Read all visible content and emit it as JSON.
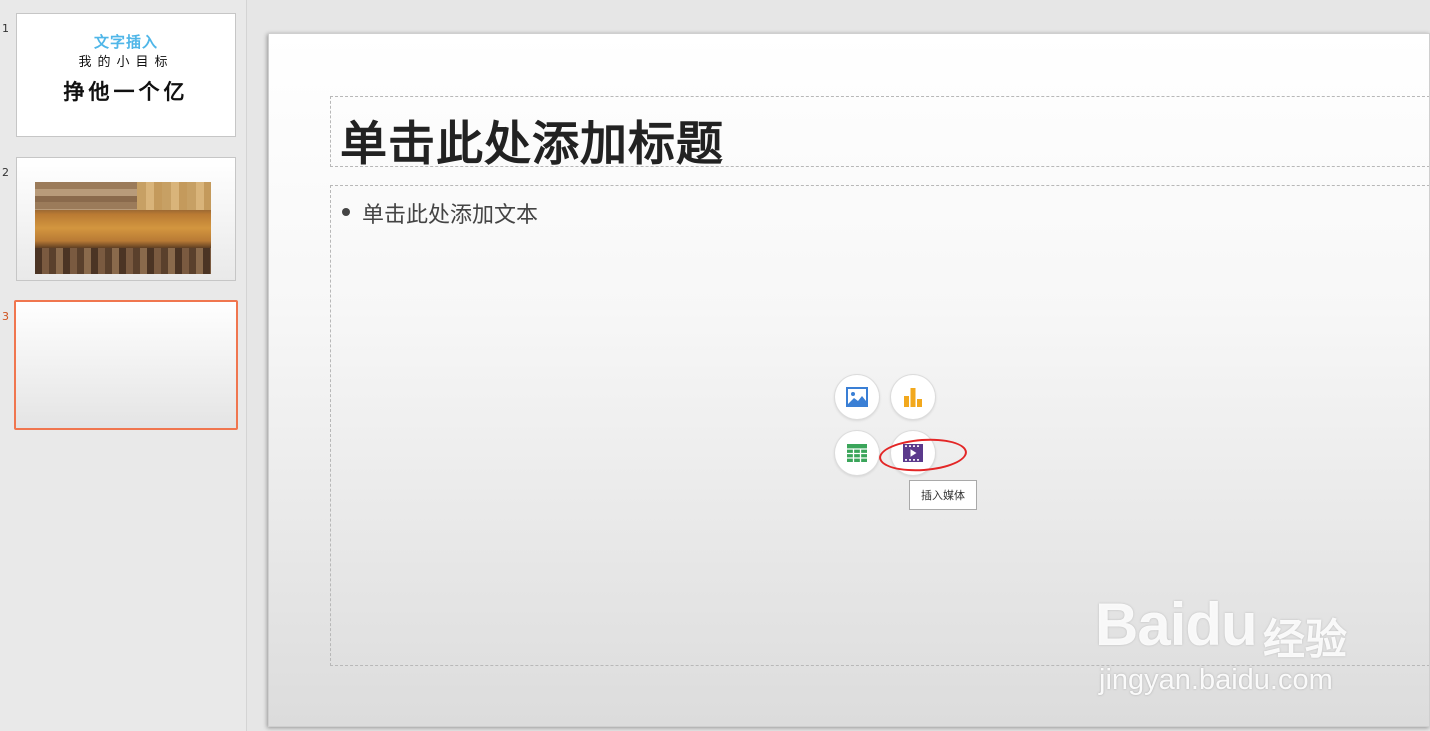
{
  "thumbnails": [
    {
      "number": "1",
      "line1": "文字插入",
      "line2": "我的小目标",
      "line3": "挣他一个亿"
    },
    {
      "number": "2"
    },
    {
      "number": "3"
    }
  ],
  "slide": {
    "title_placeholder": "单击此处添加标题",
    "body_placeholder": "单击此处添加文本"
  },
  "insert_buttons": [
    {
      "name": "insert-picture",
      "icon": "picture-icon",
      "color": "#3a7fd5"
    },
    {
      "name": "insert-chart",
      "icon": "bar-chart-icon",
      "color": "#f2a81d"
    },
    {
      "name": "insert-table",
      "icon": "table-icon",
      "color": "#3aa55a"
    },
    {
      "name": "insert-media",
      "icon": "film-icon",
      "color": "#5b3a8c"
    }
  ],
  "tooltip": "插入媒体",
  "watermark": {
    "logo": "Baidu",
    "cn": "经验",
    "url": "jingyan.baidu.com"
  }
}
